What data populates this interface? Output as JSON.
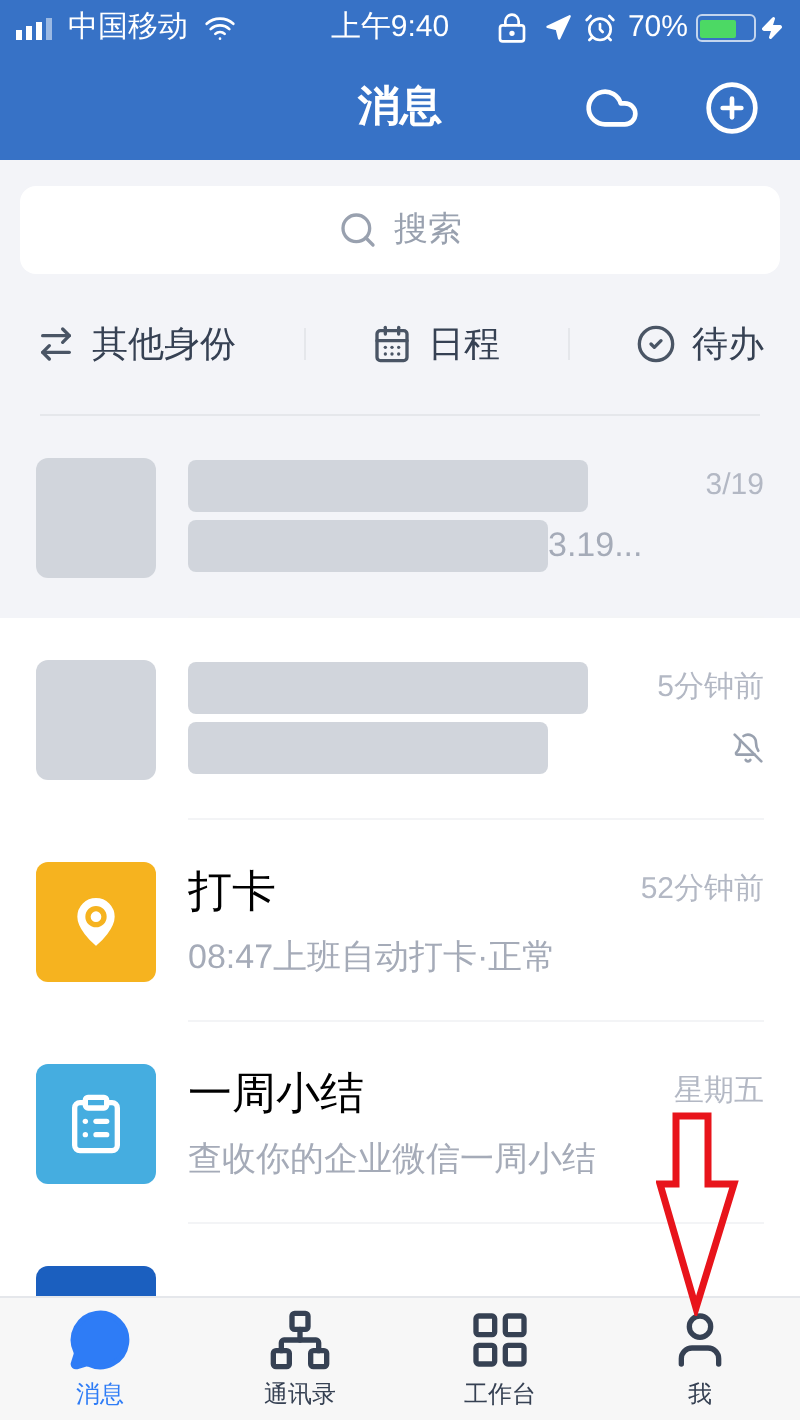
{
  "status_bar": {
    "carrier": "中国移动",
    "time": "上午9:40",
    "battery": "70%"
  },
  "header": {
    "title": "消息"
  },
  "search": {
    "placeholder": "搜索"
  },
  "shortcuts": [
    {
      "kind": "switch",
      "label": "其他身份"
    },
    {
      "kind": "calendar",
      "label": "日程"
    },
    {
      "kind": "todo",
      "label": "待办"
    }
  ],
  "chats": [
    {
      "kind": "redacted",
      "pinned": true,
      "time": "3/19",
      "preview": "3.19...",
      "muted": false
    },
    {
      "kind": "redacted",
      "pinned": false,
      "time": "5分钟前",
      "muted": true
    },
    {
      "kind": "checkin",
      "color": "#f6b31f",
      "pinned": false,
      "title": "打卡",
      "preview": "08:47上班自动打卡·正常",
      "time": "52分钟前",
      "muted": false
    },
    {
      "kind": "summary",
      "color": "#45ade0",
      "pinned": false,
      "title": "一周小结",
      "preview": "查收你的企业微信一周小结",
      "time": "星期五",
      "muted": false
    },
    {
      "kind": "tile",
      "color": "#1b5fbf",
      "pinned": false,
      "muted": false
    }
  ],
  "tabs": [
    {
      "kind": "chat",
      "label": "消息",
      "selected": true
    },
    {
      "kind": "contacts",
      "label": "通讯录",
      "selected": false
    },
    {
      "kind": "workbench",
      "label": "工作台",
      "selected": false
    },
    {
      "kind": "me",
      "label": "我",
      "selected": false
    }
  ]
}
